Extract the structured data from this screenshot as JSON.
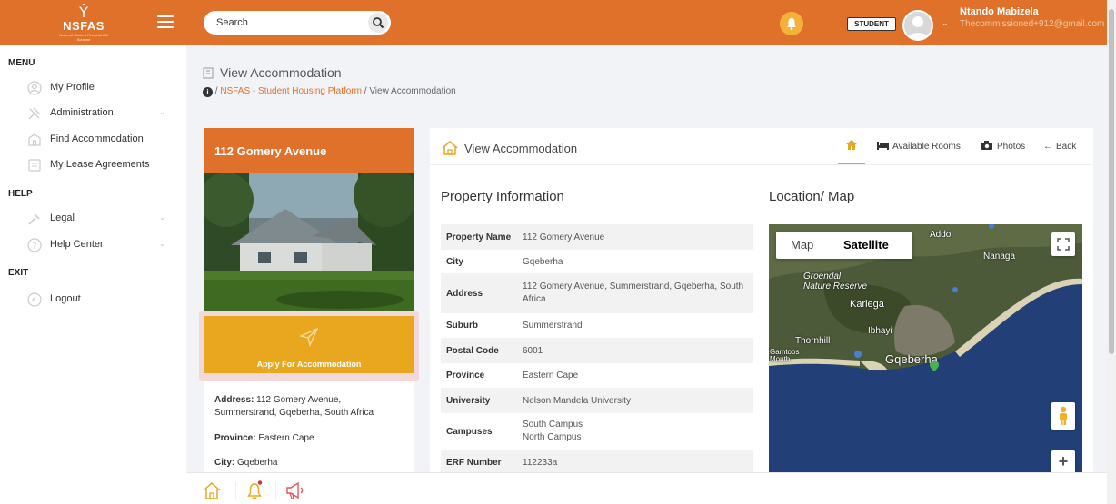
{
  "header": {
    "logo_text": "NSFAS",
    "logo_subtext": "National Student Financial Aid Scheme",
    "search_placeholder": "Search",
    "role_badge": "STUDENT",
    "user_name": "Ntando Mabizela",
    "user_email": "Thecommissioned+912@gmail.com",
    "accent_color": "#e0712b"
  },
  "sidebar": {
    "sections": [
      "MENU",
      "HELP",
      "EXIT"
    ],
    "menu_items": [
      {
        "label": "My Profile",
        "icon": "user-circle-icon"
      },
      {
        "label": "Administration",
        "icon": "tools-icon",
        "has_submenu": true
      },
      {
        "label": "Find Accommodation",
        "icon": "building-icon"
      },
      {
        "label": "My Lease Agreements",
        "icon": "document-icon"
      }
    ],
    "help_items": [
      {
        "label": "Legal",
        "icon": "gavel-icon",
        "has_submenu": true
      },
      {
        "label": "Help Center",
        "icon": "question-circle-icon",
        "has_submenu": true
      }
    ],
    "exit_items": [
      {
        "label": "Logout",
        "icon": "logout-icon"
      }
    ]
  },
  "page": {
    "title": "View Accommodation",
    "breadcrumb": {
      "link": "NSFAS - Student Housing Platform",
      "current": "View Accommodation",
      "sep": "/"
    }
  },
  "left_card": {
    "title": "112 Gomery Avenue",
    "apply_label": "Apply For Accommodation",
    "address_label": "Address:",
    "address": "112 Gomery Avenue, Summerstrand, Gqeberha, South Africa",
    "province_label": "Province:",
    "province": "Eastern Cape",
    "city_label": "City:",
    "city": "Gqeberha"
  },
  "main_card": {
    "title": "View Accommodation",
    "tabs": {
      "rooms": "Available Rooms",
      "photos": "Photos",
      "back": "Back"
    },
    "property_info_title": "Property Information",
    "location_title": "Location/ Map",
    "property_rows": [
      {
        "key": "Property Name",
        "value": "112 Gomery Avenue"
      },
      {
        "key": "City",
        "value": "Gqeberha"
      },
      {
        "key": "Address",
        "value": "112 Gomery Avenue, Summerstrand, Gqeberha, South Africa"
      },
      {
        "key": "Suburb",
        "value": "Summerstrand"
      },
      {
        "key": "Postal Code",
        "value": "6001"
      },
      {
        "key": "Province",
        "value": "Eastern Cape"
      },
      {
        "key": "University",
        "value": "Nelson Mandela University"
      },
      {
        "key": "Campuses",
        "value": "South Campus\nNorth Campus"
      },
      {
        "key": "ERF Number",
        "value": "112233a"
      }
    ]
  },
  "map": {
    "type_map": "Map",
    "type_satellite": "Satellite",
    "labels": {
      "addo": "Addo",
      "nanaga": "Nanaga",
      "groendal": "Groendal\nNature Reserve",
      "kariega": "Kariega",
      "ibhayi": "Ibhayi",
      "thornhill": "Thornhill",
      "gamtoos": "Gamtoos\nMouth",
      "gqeberha": "Gqeberha"
    },
    "zoom_in": "+"
  }
}
